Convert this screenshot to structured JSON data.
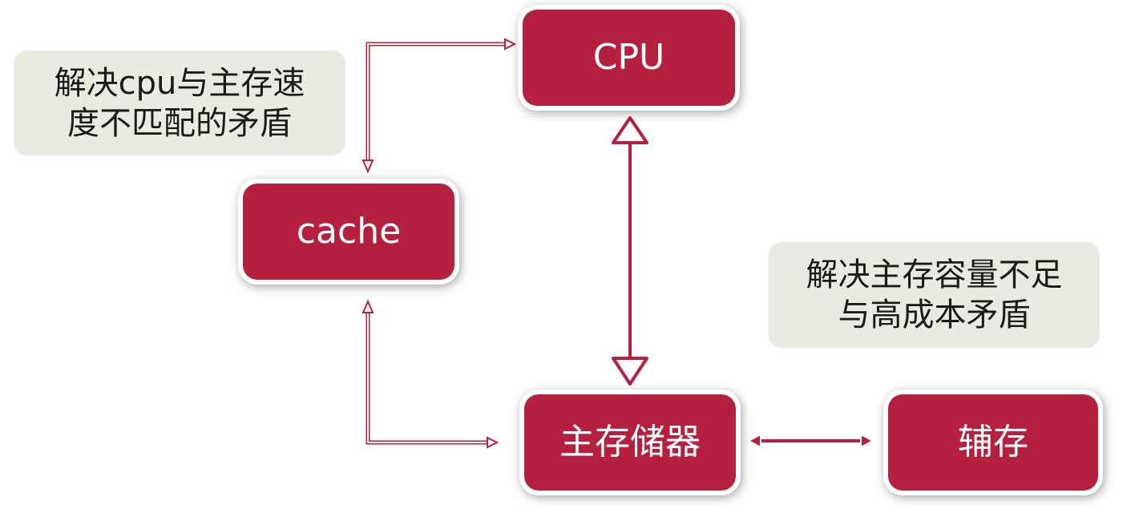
{
  "nodes": {
    "cpu": "CPU",
    "cache": "cache",
    "main_memory": "主存储器",
    "auxiliary": "辅存"
  },
  "notes": {
    "cache_purpose": {
      "line1": "解决cpu与主存速",
      "line2": "度不匹配的矛盾"
    },
    "aux_purpose": {
      "line1": "解决主存容量不足",
      "line2": "与高成本矛盾"
    }
  },
  "colors": {
    "node_fill": "#b5203f",
    "note_fill": "#ebeae0",
    "connector": "#b5203f"
  }
}
